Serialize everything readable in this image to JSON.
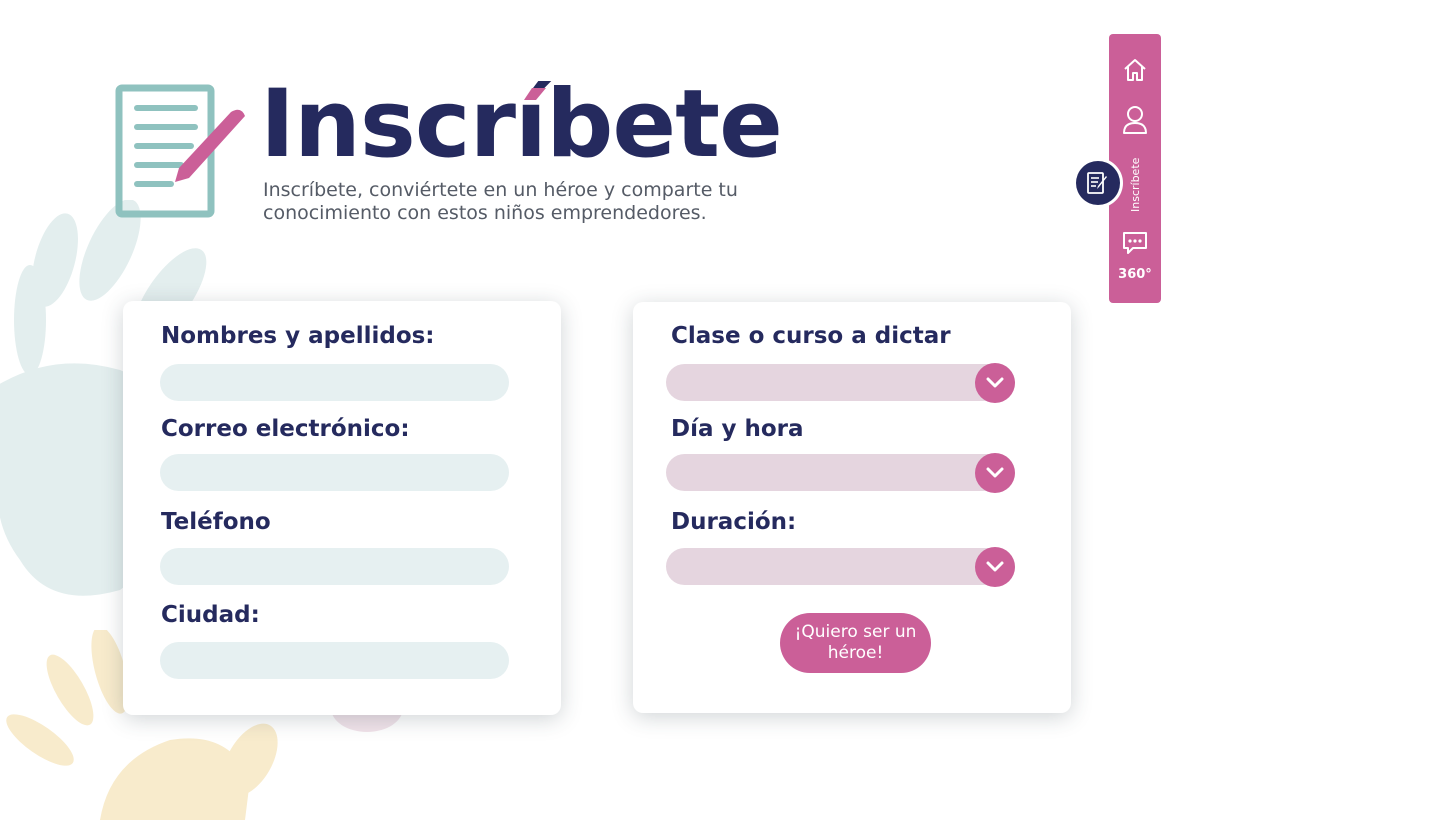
{
  "header": {
    "title": "Inscríbete",
    "subtitle": "Inscríbete, conviértete en un héroe y comparte tu conocimiento con estos niños emprendedores."
  },
  "personal_form": {
    "fields": [
      {
        "label": "Nombres y apellidos:",
        "value": ""
      },
      {
        "label": "Correo electrónico:",
        "value": ""
      },
      {
        "label": "Teléfono",
        "value": ""
      },
      {
        "label": "Ciudad:",
        "value": ""
      }
    ]
  },
  "course_form": {
    "selects": [
      {
        "label": "Clase o curso a dictar",
        "value": ""
      },
      {
        "label": "Día y hora",
        "value": ""
      },
      {
        "label": "Duración:",
        "value": ""
      }
    ],
    "submit_label": "¡Quiero ser un héroe!"
  },
  "side_nav": {
    "items": [
      {
        "icon": "home-icon"
      },
      {
        "icon": "user-icon"
      },
      {
        "icon": "edit-document-icon",
        "label": "Inscríbete",
        "active": true
      },
      {
        "icon": "chat-icon"
      },
      {
        "label": "360°"
      }
    ]
  },
  "colors": {
    "navy": "#252a5e",
    "pink": "#cb5f98",
    "teal": "#8fc2bf",
    "input_teal": "#e6f0f1",
    "input_pink": "#e5d5df"
  }
}
